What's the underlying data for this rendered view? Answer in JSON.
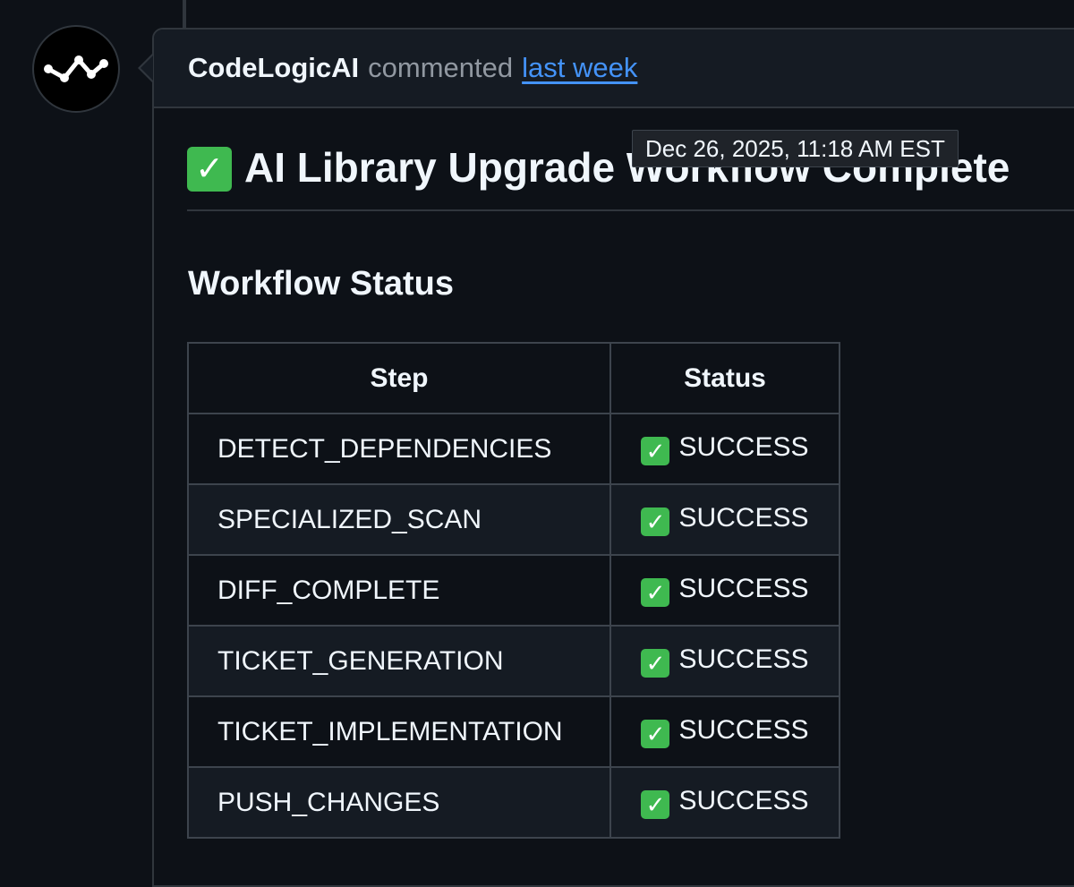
{
  "comment": {
    "author": "CodeLogicAI",
    "action": "commented",
    "time_label": "last week",
    "tooltip": "Dec 26, 2025, 11:18 AM EST",
    "avatar_icon": "codelogic-wave-icon"
  },
  "body": {
    "title": "AI Library Upgrade Workflow Complete",
    "title_icon": "white-check-mark-emoji",
    "section_heading": "Workflow Status",
    "table": {
      "headers": [
        "Step",
        "Status"
      ],
      "rows": [
        {
          "step": "DETECT_DEPENDENCIES",
          "status": "SUCCESS"
        },
        {
          "step": "SPECIALIZED_SCAN",
          "status": "SUCCESS"
        },
        {
          "step": "DIFF_COMPLETE",
          "status": "SUCCESS"
        },
        {
          "step": "TICKET_GENERATION",
          "status": "SUCCESS"
        },
        {
          "step": "TICKET_IMPLEMENTATION",
          "status": "SUCCESS"
        },
        {
          "step": "PUSH_CHANGES",
          "status": "SUCCESS"
        }
      ]
    }
  },
  "colors": {
    "background": "#0d1117",
    "header_bg": "#151b23",
    "border": "#30363d",
    "link": "#4493f8",
    "muted": "#9198a1",
    "success": "#3fb950"
  }
}
